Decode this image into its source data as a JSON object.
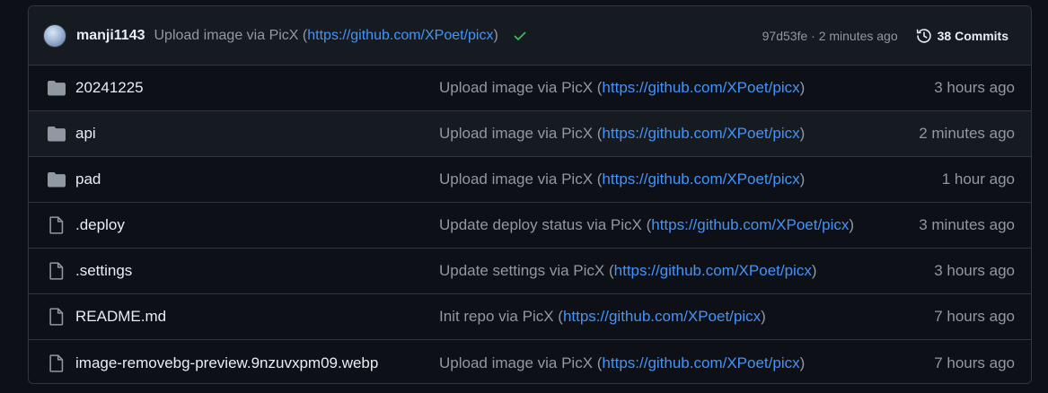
{
  "commit": {
    "author": "manji1143",
    "message_prefix": "Upload image via PicX (",
    "message_link": "https://github.com/XPoet/picx",
    "message_suffix": ")",
    "sha_time": "97d53fe · 2 minutes ago",
    "commits_label": "38 Commits"
  },
  "files": [
    {
      "name": "20241225",
      "type": "folder",
      "msg_prefix": "Upload image via PicX (",
      "msg_link": "https://github.com/XPoet/picx",
      "msg_suffix": ")",
      "age": "3 hours ago"
    },
    {
      "name": "api",
      "type": "folder",
      "msg_prefix": "Upload image via PicX (",
      "msg_link": "https://github.com/XPoet/picx",
      "msg_suffix": ")",
      "age": "2 minutes ago"
    },
    {
      "name": "pad",
      "type": "folder",
      "msg_prefix": "Upload image via PicX (",
      "msg_link": "https://github.com/XPoet/picx",
      "msg_suffix": ")",
      "age": "1 hour ago"
    },
    {
      "name": ".deploy",
      "type": "file",
      "msg_prefix": "Update deploy status via PicX (",
      "msg_link": "https://github.com/XPoet/picx",
      "msg_suffix": ")",
      "age": "3 minutes ago"
    },
    {
      "name": ".settings",
      "type": "file",
      "msg_prefix": "Update settings via PicX (",
      "msg_link": "https://github.com/XPoet/picx",
      "msg_suffix": ")",
      "age": "3 hours ago"
    },
    {
      "name": "README.md",
      "type": "file",
      "msg_prefix": "Init repo via PicX (",
      "msg_link": "https://github.com/XPoet/picx",
      "msg_suffix": ")",
      "age": "7 hours ago"
    },
    {
      "name": "image-removebg-preview.9nzuvxpm09.webp",
      "type": "file",
      "msg_prefix": "Upload image via PicX (",
      "msg_link": "https://github.com/XPoet/picx",
      "msg_suffix": ")",
      "age": "7 hours ago"
    }
  ],
  "colors": {
    "background": "#0d1117",
    "header_bg": "#161b22",
    "border": "#30363d",
    "link": "#4493f8",
    "muted": "#9198a1",
    "success": "#3fb950"
  }
}
